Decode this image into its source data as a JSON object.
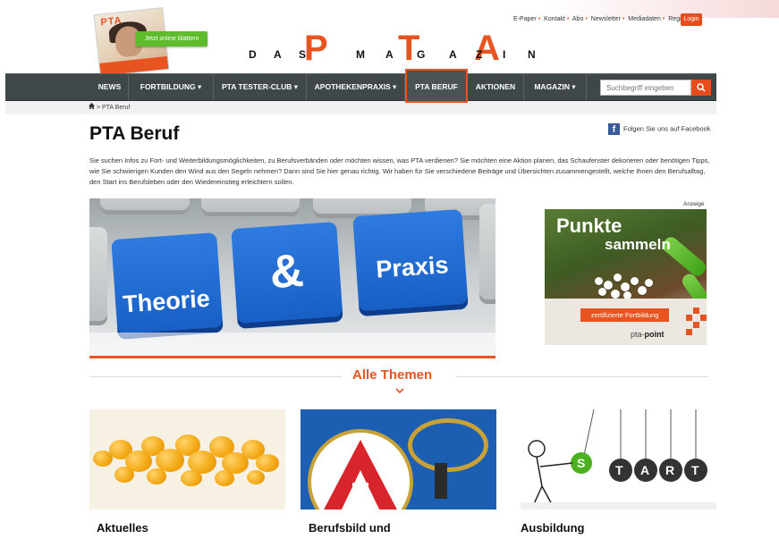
{
  "header": {
    "magazine_cta": "Jetzt online blättern",
    "cover_logo": "PTA",
    "logo_letters": [
      "P",
      "T",
      "A"
    ],
    "logo_subtitle_letters": [
      "D",
      "A",
      "S",
      "M",
      "A",
      "G",
      "A",
      "Z",
      "I",
      "N"
    ],
    "topnav": [
      "E-Paper",
      "Kontakt",
      "Abo",
      "Newsletter",
      "Mediadaten",
      "Registrieren"
    ],
    "login_label": "Login"
  },
  "mainnav": {
    "items": [
      {
        "label": "NEWS"
      },
      {
        "label": "FORTBILDUNG ▾"
      },
      {
        "label": "PTA TESTER-CLUB ▾"
      },
      {
        "label": "APOTHEKENPRAXIS ▾"
      },
      {
        "label": "PTA BERUF"
      },
      {
        "label": "AKTIONEN"
      },
      {
        "label": "MAGAZIN ▾"
      }
    ],
    "active_item": "PTA BERUF",
    "search_placeholder": "Suchbegriff eingeben"
  },
  "breadcrumb": {
    "current": "PTA Beruf"
  },
  "page": {
    "title": "PTA Beruf",
    "facebook_label": "Folgen Sie uns auf Facebook",
    "intro": "Sie suchen Infos zu Fort- und Weiterbildungsmöglichkeiten, zu Berufsverbänden oder möchten wissen, was PTA verdienen? Sie möchten eine Aktion planen, das Schaufenster dekorieren oder benötigen Tipps, wie Sie schwierigen Kunden den Wind aus den Segeln nehmen? Dann sind Sie hier genau richtig. Wir haben für Sie verschiedene Beiträge und Übersichten zusammengestellt, welche Ihnen den Berufsalltag, den Start ins Berufsleben oder den Wiedereinstieg erleichtern sollen.",
    "hero_keys": {
      "left": "Theorie",
      "middle": "&",
      "right": "Praxis"
    }
  },
  "ad": {
    "label": "Anzeige",
    "headline1": "Punkte",
    "headline2": "sammeln",
    "button": "zertifizierte Fortbildung",
    "brand_prefix": "pta-",
    "brand_bold": "point"
  },
  "themen": {
    "heading": "Alle Themen",
    "categories": [
      {
        "title": "Aktuelles"
      },
      {
        "title": "Berufsbild und"
      },
      {
        "title": "Ausbildung"
      }
    ],
    "start_letters": [
      "T",
      "A",
      "R",
      "T"
    ],
    "start_ball": "S"
  },
  "colors": {
    "accent": "#e8541f",
    "nav_bg": "#3f4749",
    "facebook": "#3b5998",
    "key_blue": "#1f6bd3"
  }
}
